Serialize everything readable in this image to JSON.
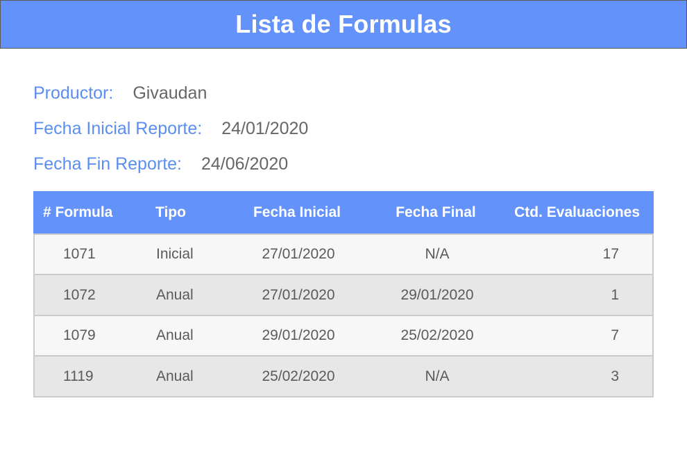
{
  "header": {
    "title": "Lista de Formulas"
  },
  "info": {
    "productor_label": "Productor:",
    "productor_value": "Givaudan",
    "fecha_inicial_label": "Fecha Inicial Reporte:",
    "fecha_inicial_value": "24/01/2020",
    "fecha_fin_label": "Fecha Fin Reporte:",
    "fecha_fin_value": "24/06/2020"
  },
  "table": {
    "columns": [
      "# Formula",
      "Tipo",
      "Fecha Inicial",
      "Fecha Final",
      "Ctd. Evaluaciones"
    ],
    "rows": [
      [
        "1071",
        "Inicial",
        "27/01/2020",
        "N/A",
        "17"
      ],
      [
        "1072",
        "Anual",
        "27/01/2020",
        "29/01/2020",
        "1"
      ],
      [
        "1079",
        "Anual",
        "29/01/2020",
        "25/02/2020",
        "7"
      ],
      [
        "1119",
        "Anual",
        "25/02/2020",
        "N/A",
        "3"
      ]
    ]
  },
  "colors": {
    "accent": "#6392fb",
    "label": "#5b8ef2",
    "value": "#666666",
    "row_odd": "#f7f7f7",
    "row_even": "#e7e7e7"
  }
}
